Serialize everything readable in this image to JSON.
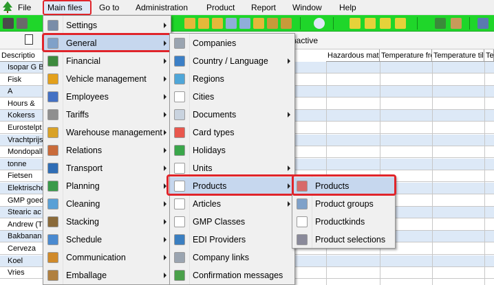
{
  "menubar": {
    "items": [
      {
        "label": "File",
        "accel": "F"
      },
      {
        "label": "Main files",
        "accel": "M"
      },
      {
        "label": "Go to",
        "accel": "G"
      },
      {
        "label": "Administration",
        "accel": "A"
      },
      {
        "label": "Product",
        "accel": ""
      },
      {
        "label": "Report",
        "accel": "R"
      },
      {
        "label": "Window",
        "accel": "W"
      },
      {
        "label": "Help",
        "accel": "H"
      }
    ]
  },
  "tabs": {
    "inactive_label": "nactive"
  },
  "grid": {
    "columns": [
      "Descriptio",
      "Hazardous mat",
      "Temperature fro",
      "Temperature till",
      "Te"
    ],
    "rows": [
      "Isopar G B",
      "Fisk",
      "A",
      "Hours &",
      "Kokerss",
      "Eurostelpt",
      "Vrachtprijs",
      "Mondopall",
      "tonne",
      "Fietsen",
      "Elektrische",
      "GMP goed",
      "Stearic ac",
      "Andrew (T",
      "Bakbanan",
      "Cerveza",
      "Koel",
      "Vries"
    ]
  },
  "main_files_menu": {
    "items": [
      {
        "label": "Settings",
        "icon": "wrench-icon",
        "color": "#7a8da8",
        "arrow": true
      },
      {
        "label": "General",
        "icon": "general-icon",
        "color": "#7fa1c9",
        "arrow": true
      },
      {
        "label": "Financial",
        "icon": "financial-icon",
        "color": "#3e8a3e",
        "arrow": true
      },
      {
        "label": "Vehicle management",
        "icon": "truck-icon",
        "color": "#e3a01b",
        "arrow": true
      },
      {
        "label": "Employees",
        "icon": "employees-icon",
        "color": "#4471c4",
        "arrow": true
      },
      {
        "label": "Tariffs",
        "icon": "calculator-icon",
        "color": "#8f8f8f",
        "arrow": true
      },
      {
        "label": "Warehouse management",
        "icon": "warehouse-icon",
        "color": "#d9a227",
        "arrow": true
      },
      {
        "label": "Relations",
        "icon": "relations-icon",
        "color": "#c96b3a",
        "arrow": true
      },
      {
        "label": "Transport",
        "icon": "transport-icon",
        "color": "#2f6db5",
        "arrow": true
      },
      {
        "label": "Planning",
        "icon": "planning-icon",
        "color": "#3a9a4a",
        "arrow": true
      },
      {
        "label": "Cleaning",
        "icon": "cleaning-icon",
        "color": "#5aa0d6",
        "arrow": true
      },
      {
        "label": "Stacking",
        "icon": "stacking-icon",
        "color": "#8a6a3a",
        "arrow": true
      },
      {
        "label": "Schedule",
        "icon": "schedule-icon",
        "color": "#4a8ad0",
        "arrow": true
      },
      {
        "label": "Communication",
        "icon": "communication-icon",
        "color": "#d08a2a",
        "arrow": true
      },
      {
        "label": "Emballage",
        "icon": "emballage-icon",
        "color": "#b08040",
        "arrow": true
      }
    ]
  },
  "general_menu": {
    "items": [
      {
        "label": "Companies",
        "icon": "companies-icon",
        "color": "#9aa4b0",
        "arrow": false
      },
      {
        "label": "Country / Language",
        "icon": "globe-icon",
        "color": "#3b7fc6",
        "arrow": true
      },
      {
        "label": "Regions",
        "icon": "regions-icon",
        "color": "#4fa6d8",
        "arrow": false
      },
      {
        "label": "Cities",
        "icon": "cities-icon",
        "color": "#ffffff",
        "arrow": false
      },
      {
        "label": "Documents",
        "icon": "documents-icon",
        "color": "#c9d3df",
        "arrow": true
      },
      {
        "label": "Card types",
        "icon": "card-icon",
        "color": "#e8574d",
        "arrow": false
      },
      {
        "label": "Holidays",
        "icon": "palm-icon",
        "color": "#3aa64a",
        "arrow": false
      },
      {
        "label": "Units",
        "icon": "units-icon",
        "color": "#ffffff",
        "arrow": true
      },
      {
        "label": "Products",
        "icon": "products-icon",
        "color": "#ffffff",
        "arrow": true
      },
      {
        "label": "Articles",
        "icon": "articles-icon",
        "color": "#ffffff",
        "arrow": true
      },
      {
        "label": "GMP Classes",
        "icon": "gmp-icon",
        "color": "#ffffff",
        "arrow": false
      },
      {
        "label": "EDI Providers",
        "icon": "edi-icon",
        "color": "#3a7ec0",
        "arrow": false
      },
      {
        "label": "Company links",
        "icon": "company-links-icon",
        "color": "#9aa4b0",
        "arrow": false
      },
      {
        "label": "Confirmation messages",
        "icon": "confirm-icon",
        "color": "#4aa04a",
        "arrow": false
      }
    ]
  },
  "products_menu": {
    "items": [
      {
        "label": "Products",
        "icon": "product-box-icon",
        "color": "#d86a6a"
      },
      {
        "label": "Product groups",
        "icon": "product-groups-icon",
        "color": "#7fa1c9"
      },
      {
        "label": "Productkinds",
        "icon": "productkinds-icon",
        "color": "#ffffff"
      },
      {
        "label": "Product selections",
        "icon": "product-selections-icon",
        "color": "#8a8a9a"
      }
    ]
  },
  "colors": {
    "toolbar": "#1fd62a",
    "highlight": "#c6d7ee",
    "callout": "#e0242a"
  }
}
